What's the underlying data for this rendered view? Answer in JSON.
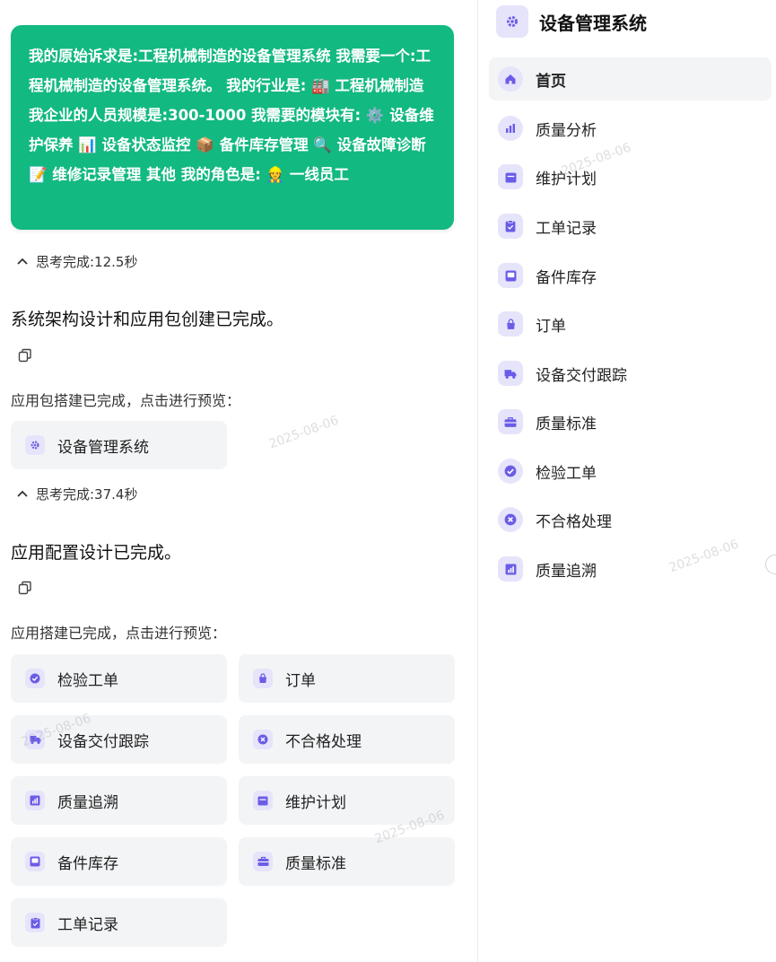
{
  "user_message": "我的原始诉求是:工程机械制造的设备管理系统 我需要一个:工程机械制造的设备管理系统。 我的行业是: 🏭 工程机械制造 我企业的人员规模是:300-1000 我需要的模块有: ⚙️ 设备维护保养 📊 设备状态监控 📦 备件库存管理 🔍 设备故障诊断 📝 维修记录管理 其他 我的角色是: 👷 一线员工",
  "thinking": [
    {
      "label": "思考完成:12.5秒"
    },
    {
      "label": "思考完成:37.4秒"
    }
  ],
  "responses": [
    {
      "heading": "系统架构设计和应用包创建已完成。",
      "subtext": "应用包搭建已完成，点击进行预览："
    },
    {
      "heading": "应用配置设计已完成。",
      "subtext": "应用搭建已完成，点击进行预览："
    }
  ],
  "package_card": {
    "label": "设备管理系统",
    "icon": "gear-icon"
  },
  "app_cards": [
    {
      "label": "检验工单",
      "icon": "check-circle-icon"
    },
    {
      "label": "订单",
      "icon": "bag-icon"
    },
    {
      "label": "设备交付跟踪",
      "icon": "truck-icon"
    },
    {
      "label": "不合格处理",
      "icon": "x-circle-icon"
    },
    {
      "label": "质量追溯",
      "icon": "chart-icon"
    },
    {
      "label": "维护计划",
      "icon": "calendar-icon"
    },
    {
      "label": "备件库存",
      "icon": "inbox-icon"
    },
    {
      "label": "质量标准",
      "icon": "briefcase-icon"
    },
    {
      "label": "工单记录",
      "icon": "clipboard-icon"
    }
  ],
  "sidebar": {
    "title": "设备管理系统",
    "items": [
      {
        "label": "首页",
        "icon": "home-icon",
        "active": true
      },
      {
        "label": "质量分析",
        "icon": "bar-chart-icon"
      },
      {
        "label": "维护计划",
        "icon": "calendar-icon"
      },
      {
        "label": "工单记录",
        "icon": "clipboard-icon"
      },
      {
        "label": "备件库存",
        "icon": "inbox-icon"
      },
      {
        "label": "订单",
        "icon": "bag-icon"
      },
      {
        "label": "设备交付跟踪",
        "icon": "truck-icon"
      },
      {
        "label": "质量标准",
        "icon": "briefcase-icon"
      },
      {
        "label": "检验工单",
        "icon": "check-circle-icon"
      },
      {
        "label": "不合格处理",
        "icon": "x-circle-icon"
      },
      {
        "label": "质量追溯",
        "icon": "chart-icon"
      }
    ]
  },
  "watermark": "2025-08-06",
  "colors": {
    "accent": "#6b5ce7",
    "bubble": "#12b981"
  }
}
